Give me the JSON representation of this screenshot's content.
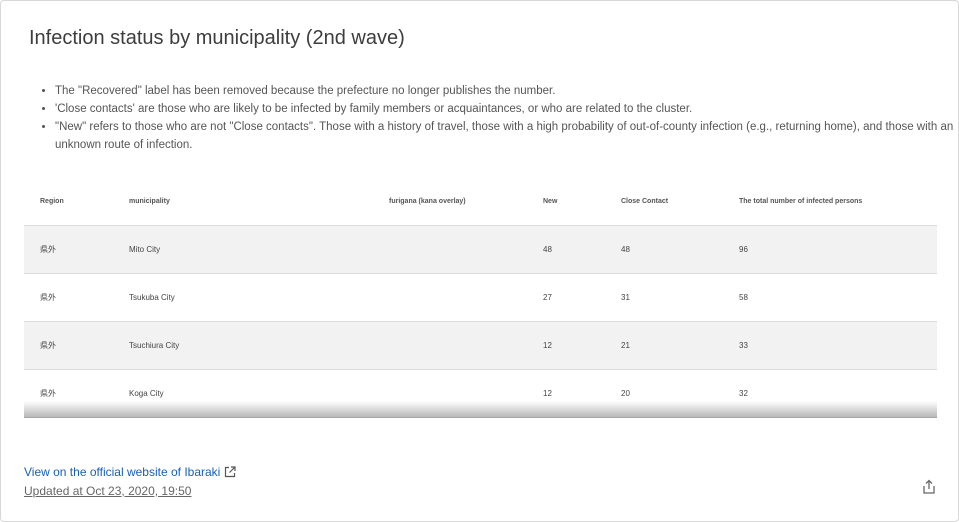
{
  "card": {
    "title": "Infection status by municipality (2nd wave)",
    "notes": [
      "The \"Recovered\" label has been removed because the prefecture no longer publishes the number.",
      "'Close contacts' are those who are likely to be infected by family members or acquaintances, or who are related to the cluster.",
      "\"New\" refers to those who are not \"Close contacts\". Those with a history of travel, those with a high probability of out-of-county infection (e.g., returning home), and those with an unknown route of infection."
    ]
  },
  "table": {
    "headers": [
      "Region",
      "municipality",
      "furigana (kana overlay)",
      "New",
      "Close Contact",
      "The total number of infected persons"
    ],
    "rows": [
      [
        "県外",
        "Mito City",
        "",
        "48",
        "48",
        "96"
      ],
      [
        "県外",
        "Tsukuba City",
        "",
        "27",
        "31",
        "58"
      ],
      [
        "県外",
        "Tsuchiura City",
        "",
        "12",
        "21",
        "33"
      ],
      [
        "県外",
        "Koga City",
        "",
        "12",
        "20",
        "32"
      ]
    ]
  },
  "footer": {
    "link_text": "View on the official website of Ibaraki",
    "updated_text": "Updated at Oct 23, 2020, 19:50",
    "link_icon": "external-link-icon",
    "share_icon": "share-icon"
  },
  "colors": {
    "link": "#1a5fb4",
    "row_stripe": "#f2f2f2"
  }
}
